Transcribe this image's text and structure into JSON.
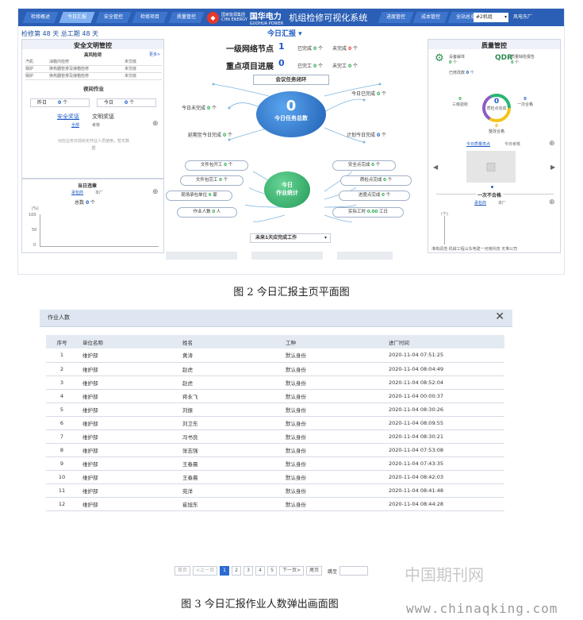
{
  "fig2": {
    "nav": {
      "tabs": [
        "检修概述",
        "今日汇报",
        "安全管控",
        "检修项目",
        "质量管控"
      ],
      "right_tabs": [
        "进度管控",
        "成本管控",
        "全站总览"
      ],
      "unit_select": "#2机组",
      "plant": "风电东厂",
      "brand_small1": "国家能源集团",
      "brand_small2": "CHN ENERGY",
      "brand_cn": "国华电力",
      "brand_en": "GUOHUA POWER",
      "system_title": "机组检修可视化系统"
    },
    "header": {
      "days_label": "检修第 48 天 总工期 48 天",
      "center_title": "今日汇报",
      "net_node_label": "一级网络节点",
      "key_project_label": "重点项目进展",
      "node_done": "已完成",
      "node_todo": "未完成",
      "node_done_val": "0",
      "node_todo_val": "0",
      "proj_done": "已完工",
      "proj_todo": "未完工",
      "proj_done_val": "0",
      "proj_todo_val": "0",
      "node_big": "1",
      "proj_big": "0"
    },
    "safety": {
      "title": "安全文明管控",
      "subtitle": "高风险项",
      "more": "更多>",
      "rows": [
        [
          "汽机",
          "油箱内检修",
          "未交底"
        ],
        [
          "锅炉",
          "换热器管排及接箱检修",
          "未交底"
        ],
        [
          "锅炉",
          "换热器管排及接箱检修",
          "未交底"
        ]
      ],
      "night_title": "夜间作业",
      "yesterday": "昨日",
      "yesterday_val": "0",
      "today": "今日",
      "today_val": "0",
      "tab1": "安全奖惩",
      "tab2": "文明奖惩",
      "sub1": "全部",
      "sub2": "考核",
      "empty": "对应业务日前尚无作业人员使用，暂无数据",
      "issue_title": "当日违章",
      "issue_sub1": "承包商",
      "issue_sub2": "本厂",
      "total_label": "总数",
      "total_val": "0",
      "y_ticks": [
        "100",
        "50",
        "0"
      ],
      "y_unit": "(%)"
    },
    "center": {
      "meeting": "会议任务闭环",
      "task_total": "今日任务总数",
      "task_total_val": "0",
      "today_undone": "今日未完成",
      "today_undone_val": "0",
      "delayed": "延期至今日完成",
      "delayed_val": "0",
      "today_done": "今日已完成",
      "today_done_val": "0",
      "plan_done": "计划今日完成",
      "plan_done_val": "0",
      "stats_title1": "今日",
      "stats_title2": "作业统计",
      "left_items": [
        {
          "label": "文件包开工",
          "val": "0",
          "unit": "个"
        },
        {
          "label": "文件包完工",
          "val": "0",
          "unit": "个"
        },
        {
          "label": "现场承包单位",
          "val": "6",
          "unit": "家"
        },
        {
          "label": "作业人数",
          "val": "0",
          "unit": "人"
        }
      ],
      "right_items": [
        {
          "label": "安全点完成",
          "val": "0",
          "unit": "个"
        },
        {
          "label": "质检点完成",
          "val": "0",
          "unit": "个"
        },
        {
          "label": "进度点完成",
          "val": "0",
          "unit": "个"
        },
        {
          "label": "实际工时",
          "val": "0.00",
          "unit": "工日"
        }
      ],
      "select": "未来1天应完成工作"
    },
    "quality": {
      "title": "质量管控",
      "item1": "设备解体",
      "item1_val": "0",
      "item2": "质量缺陷报告",
      "item2_val": "0",
      "item3": "已修改数",
      "item3_val": "0",
      "ring_center": "质检点完成",
      "ring_center_val": "0",
      "r_left": "三级验收",
      "r_left_val": "0",
      "r_right": "一次合格",
      "r_right_val": "0",
      "r_bottom": "整改合格",
      "r_bottom_val": "0",
      "photo_tab1": "今日质量亮点",
      "photo_tab2": "今日考核",
      "fail_title": "一次不合格",
      "fail_sub1": "承包商",
      "fail_sub2": "本厂",
      "y_unit": "(个)",
      "footer": "淮南润浩 机械工程山东电建一河南科技 天堆公司"
    }
  },
  "caption2": "图 2  今日汇报主页平面图",
  "fig3": {
    "title": "作业人数",
    "columns": [
      "序号",
      "单位名称",
      "姓名",
      "工种",
      "进厂时间"
    ],
    "rows": [
      [
        "1",
        "维护部",
        "黄涛",
        "默认身份",
        "2020-11-04 07:51:25"
      ],
      [
        "2",
        "维护部",
        "赵虎",
        "默认身份",
        "2020-11-04 08:04:49"
      ],
      [
        "3",
        "维护部",
        "赵虎",
        "默认身份",
        "2020-11-04 08:52:04"
      ],
      [
        "4",
        "维护部",
        "蒋永飞",
        "默认身份",
        "2020-11-04 00:00:37"
      ],
      [
        "5",
        "维护部",
        "刘振",
        "默认身份",
        "2020-11-04 08:30:26"
      ],
      [
        "6",
        "维护部",
        "刘卫东",
        "默认身份",
        "2020-11-04 08:09:55"
      ],
      [
        "7",
        "维护部",
        "冯书良",
        "默认身份",
        "2020-11-04 08:30:21"
      ],
      [
        "8",
        "维护部",
        "张志强",
        "默认身份",
        "2020-11-04 07:53:08"
      ],
      [
        "9",
        "维护部",
        "王春晨",
        "默认身份",
        "2020-11-04 07:43:35"
      ],
      [
        "10",
        "维护部",
        "王春晨",
        "默认身份",
        "2020-11-04 08:42:03"
      ],
      [
        "11",
        "维护部",
        "苑洋",
        "默认身份",
        "2020-11-04 08:41:48"
      ],
      [
        "12",
        "维护部",
        "崔旭东",
        "默认身份",
        "2020-11-04 08:44:28"
      ]
    ],
    "pager": {
      "first": "首页",
      "prev": "<上一页",
      "pages": [
        "1",
        "2",
        "3",
        "4",
        "5"
      ],
      "next": "下一页>",
      "last": "尾页",
      "jump": "跳至"
    }
  },
  "caption3": "图 3  今日汇报作业人数弹出画面图",
  "watermark": {
    "cn": "中国期刊网",
    "url": "www.chinaqking.com"
  }
}
